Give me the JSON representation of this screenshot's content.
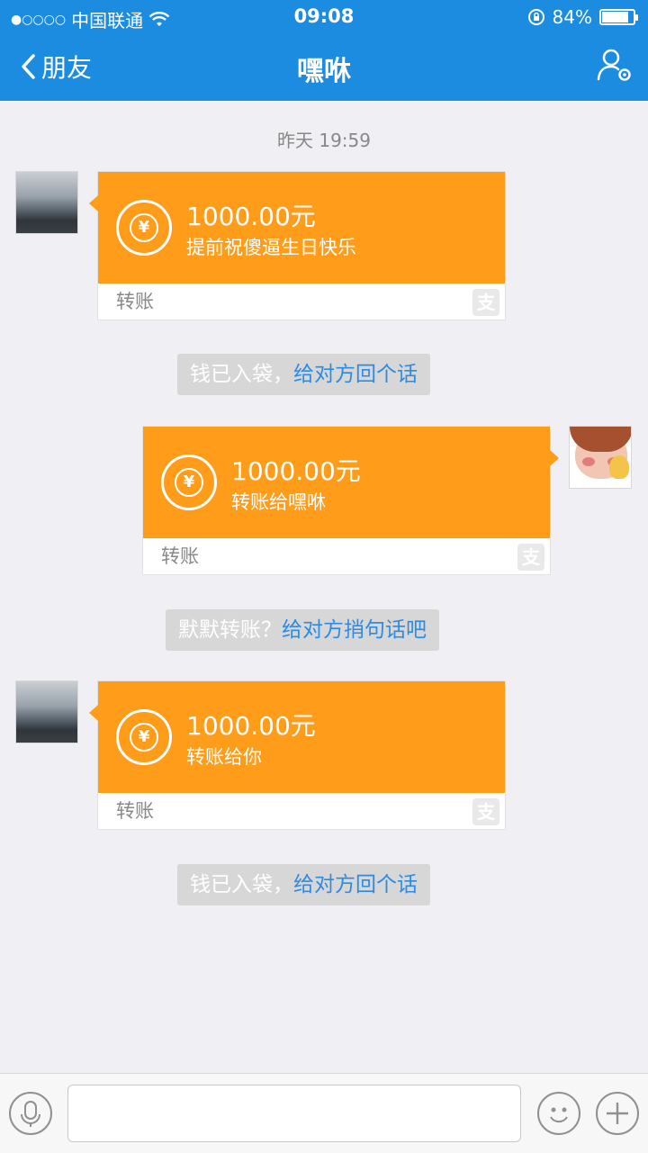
{
  "status": {
    "signal": "●○○○○",
    "carrier": "中国联通",
    "time": "09:08",
    "battery_text": "84%",
    "battery_level": 0.84
  },
  "nav": {
    "back_label": "朋友",
    "title": "嘿咻"
  },
  "chat": {
    "timestamp": "昨天 19:59",
    "messages": [
      {
        "amount": "1000.00元",
        "memo": "提前祝傻逼生日快乐",
        "label": "转账",
        "alipay_glyph": "支"
      },
      {
        "amount": "1000.00元",
        "memo": "转账给嘿咻",
        "label": "转账",
        "alipay_glyph": "支"
      },
      {
        "amount": "1000.00元",
        "memo": "转账给你",
        "label": "转账",
        "alipay_glyph": "支"
      }
    ],
    "notices": [
      {
        "text": "钱已入袋，",
        "link": "给对方回个话"
      },
      {
        "text": "默默转账？",
        "link": "给对方捎句话吧"
      },
      {
        "text": "钱已入袋，",
        "link": "给对方回个话"
      }
    ]
  },
  "colors": {
    "nav_blue": "#1b8ce0",
    "card_orange": "#ff9c1a",
    "link_blue": "#2d8be3",
    "chat_bg": "#efeff4"
  },
  "icons": [
    "back-chevron-icon",
    "wifi-icon",
    "lock-rotation-icon",
    "profile-settings-icon",
    "yuan-coin-icon",
    "alipay-icon",
    "microphone-icon",
    "emoji-icon",
    "plus-icon"
  ]
}
